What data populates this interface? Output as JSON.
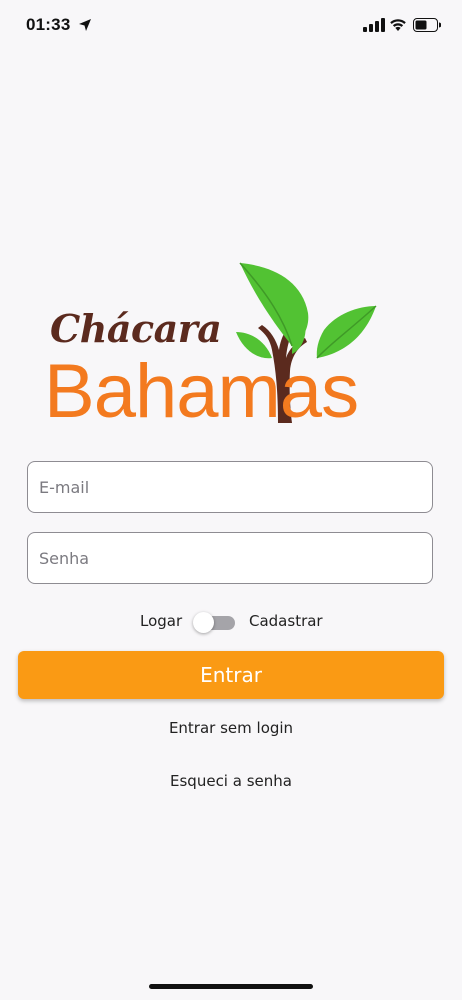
{
  "status_bar": {
    "time": "01:33",
    "icons": [
      "location-arrow-icon",
      "signal-icon",
      "wifi-icon",
      "battery-icon"
    ]
  },
  "logo": {
    "script_text": "Chácara",
    "main_text": "Bahamas",
    "colors": {
      "script": "#5b2a1e",
      "main": "#f37a1f",
      "leaf": "#52c233",
      "trunk": "#5b2a1e"
    }
  },
  "form": {
    "email_placeholder": "E-mail",
    "password_placeholder": "Senha",
    "toggle_left_label": "Logar",
    "toggle_right_label": "Cadastrar",
    "submit_label": "Entrar"
  },
  "links": {
    "guest_login": "Entrar sem login",
    "forgot_password": "Esqueci a senha"
  },
  "colors": {
    "background": "#f8f7f9",
    "accent": "#fa9a14"
  }
}
